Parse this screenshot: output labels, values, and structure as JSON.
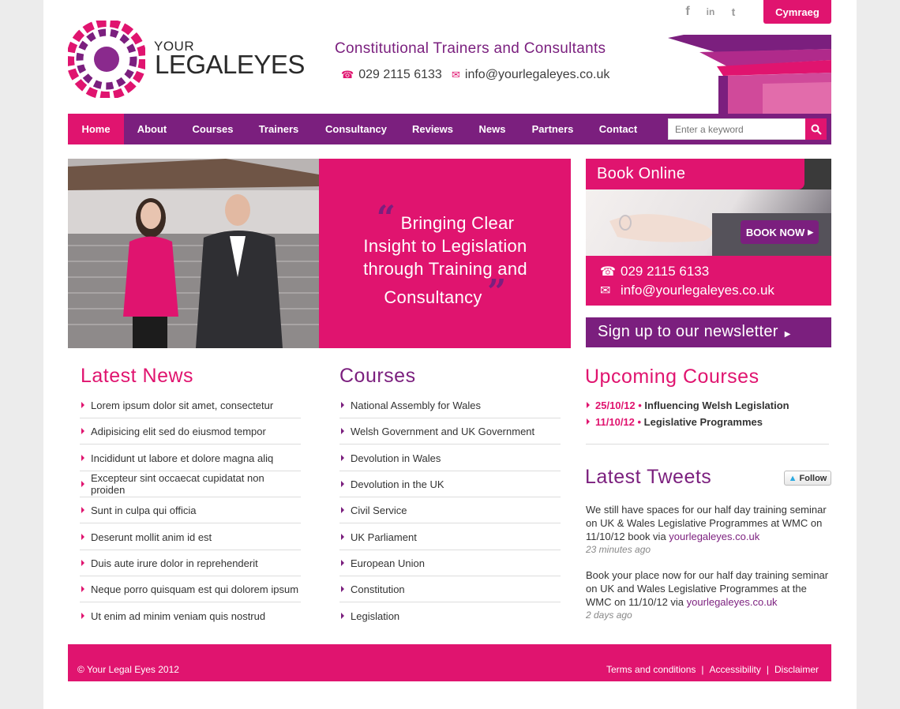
{
  "header": {
    "social": [
      "f",
      "in",
      "t"
    ],
    "language_button": "Cymraeg",
    "logo": {
      "line1": "YOUR",
      "line2": "LEGALEYES"
    },
    "tagline": "Constitutional Trainers and Consultants",
    "phone": "029 2115 6133",
    "email": "info@yourlegaleyes.co.uk"
  },
  "nav": {
    "items": [
      "Home",
      "About",
      "Courses",
      "Trainers",
      "Consultancy",
      "Reviews",
      "News",
      "Partners",
      "Contact"
    ],
    "active": "Home",
    "search_placeholder": "Enter a keyword"
  },
  "hero": {
    "quote_open": "“",
    "quote_lines": [
      "Bringing Clear",
      "Insight to Legislation",
      "through Training and",
      "Consultancy"
    ],
    "quote_close": "”"
  },
  "book": {
    "title": "Book Online",
    "button": "BOOK NOW",
    "phone": "029 2115 6133",
    "email": "info@yourlegaleyes.co.uk",
    "newsletter": "Sign up to our newsletter"
  },
  "latest_news": {
    "title": "Latest News",
    "items": [
      "Lorem ipsum dolor sit amet, consectetur",
      "Adipisicing elit sed do eiusmod tempor",
      "Incididunt ut labore et dolore magna aliq",
      "Excepteur sint occaecat cupidatat non proiden",
      "Sunt in culpa qui officia",
      "Deserunt mollit anim id est",
      "Duis aute irure dolor in reprehenderit",
      "Neque porro quisquam est qui dolorem ipsum",
      "Ut enim ad minim veniam quis nostrud"
    ]
  },
  "courses": {
    "title": "Courses",
    "items": [
      "National Assembly for Wales",
      "Welsh Government and UK Government",
      "Devolution in Wales",
      "Devolution in the UK",
      "Civil Service",
      "UK Parliament",
      "European Union",
      "Constitution",
      "Legislation"
    ]
  },
  "upcoming": {
    "title": "Upcoming Courses",
    "items": [
      {
        "date": "25/10/12",
        "name": "Influencing Welsh Legislation"
      },
      {
        "date": "11/10/12",
        "name": "Legislative Programmes"
      }
    ]
  },
  "tweets": {
    "title": "Latest Tweets",
    "follow": "Follow",
    "items": [
      {
        "text": "We still have spaces for our half day training seminar on UK & Wales Legislative Programmes at WMC on 11/10/12 book via ",
        "link": "yourlegaleyes.co.uk",
        "time": "23 minutes ago"
      },
      {
        "text": "Book your place now for our half day training seminar on UK and Wales Legislative Programmes at the WMC on 11/10/12 via ",
        "link": "yourlegaleyes.co.uk",
        "time": "2 days ago"
      }
    ]
  },
  "footer": {
    "copyright": "© Your Legal Eyes 2012",
    "links": [
      "Terms and conditions",
      "Accessibility",
      "Disclaimer"
    ],
    "separator": "|"
  },
  "colors": {
    "pink": "#e0146f",
    "purple": "#7b1f7e"
  }
}
